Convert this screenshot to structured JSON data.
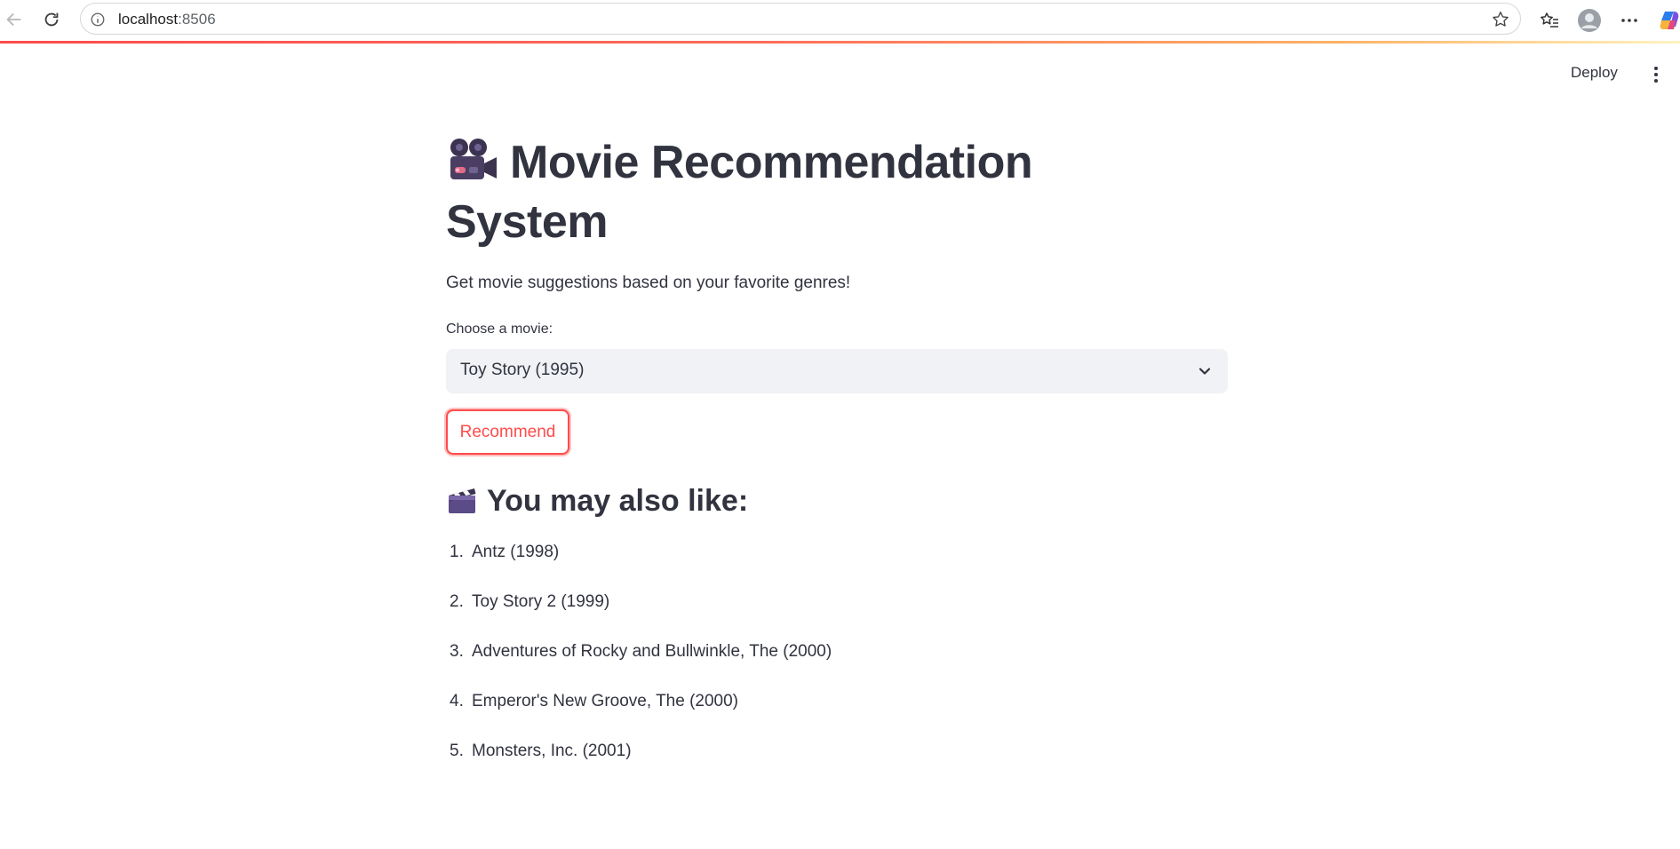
{
  "browser": {
    "url_host": "localhost",
    "url_port": ":8506"
  },
  "app_header": {
    "deploy_label": "Deploy"
  },
  "main": {
    "title_line1": "Movie Recommendation",
    "title_line2": "System",
    "title_icon": "movie-camera-icon",
    "subtitle": "Get movie suggestions based on your favorite genres!",
    "select_label": "Choose a movie:",
    "select_value": "Toy Story (1995)",
    "recommend_label": "Recommend",
    "section_title": "You may also like:",
    "section_icon": "clapper-board-icon",
    "recommendations": [
      {
        "num": "1.",
        "title": "Antz (1998)"
      },
      {
        "num": "2.",
        "title": "Toy Story 2 (1999)"
      },
      {
        "num": "3.",
        "title": "Adventures of Rocky and Bullwinkle, The (2000)"
      },
      {
        "num": "4.",
        "title": "Emperor's New Groove, The (2000)"
      },
      {
        "num": "5.",
        "title": "Monsters, Inc. (2001)"
      }
    ]
  },
  "colors": {
    "accent": "#ff4b4b",
    "text": "#31333f",
    "select_bg": "#f0f2f6"
  }
}
